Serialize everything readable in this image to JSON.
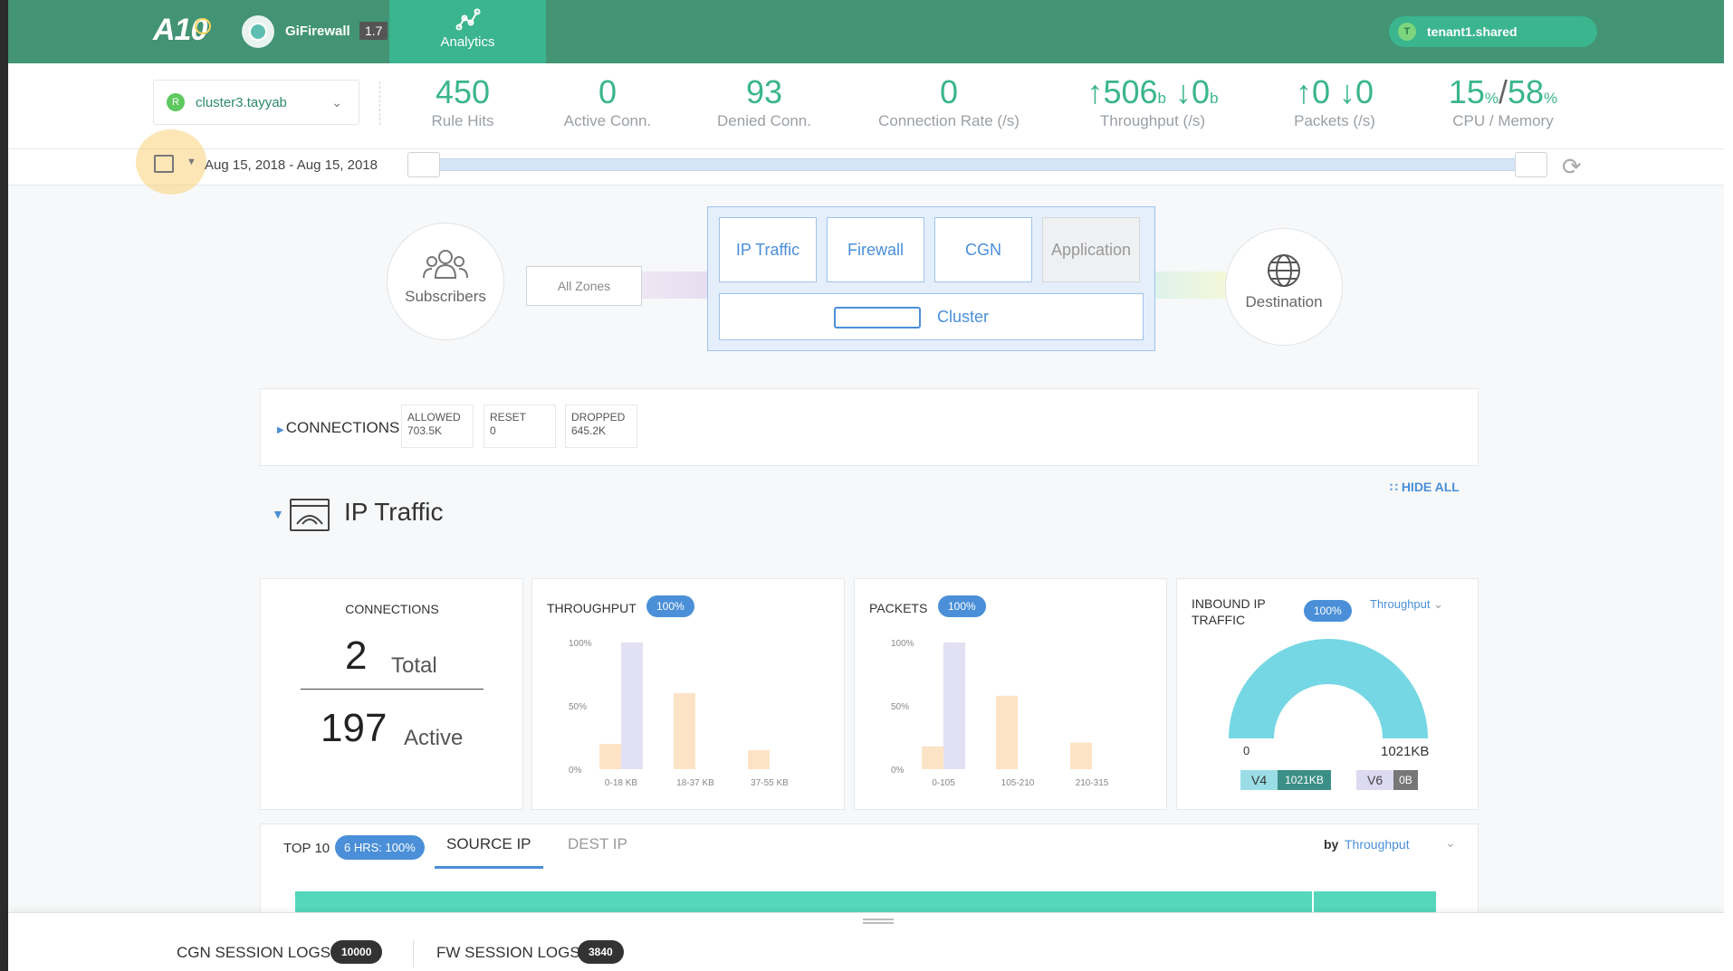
{
  "header": {
    "logo": "A10",
    "product": "GiFirewall",
    "version": "1.7",
    "analytics_tab": "Analytics",
    "tenant_initial": "T",
    "tenant": "tenant1.shared"
  },
  "cluster": {
    "initial": "R",
    "name": "cluster3.tayyab"
  },
  "stats": {
    "rule_hits": {
      "value": "450",
      "label": "Rule Hits"
    },
    "active_conn": {
      "value": "0",
      "label": "Active Conn."
    },
    "denied_conn": {
      "value": "93",
      "label": "Denied Conn."
    },
    "conn_rate": {
      "value": "0",
      "label": "Connection Rate (/s)"
    },
    "throughput": {
      "up": "↑506",
      "up_unit": "b",
      "down": "↓0",
      "down_unit": "b",
      "label": "Throughput (/s)"
    },
    "packets": {
      "up": "↑0",
      "down": "↓0",
      "label": "Packets (/s)"
    },
    "cpu_mem": {
      "cpu": "15",
      "cpu_unit": "%",
      "sep": "/",
      "mem": "58",
      "mem_unit": "%",
      "label": "CPU / Memory"
    }
  },
  "date_range": "Aug 15, 2018 - Aug 15, 2018",
  "topology": {
    "subscribers": "Subscribers",
    "all_zones": "All Zones",
    "buttons": [
      "IP Traffic",
      "Firewall",
      "CGN",
      "Application"
    ],
    "cluster": "Cluster",
    "destination": "Destination"
  },
  "connections_summary": {
    "title": "CONNECTIONS",
    "allowed_label": "ALLOWED",
    "allowed_value": "703.5K",
    "reset_label": "RESET",
    "reset_value": "0",
    "dropped_label": "DROPPED",
    "dropped_value": "645.2K"
  },
  "hide_all": "HIDE ALL",
  "section_title": "IP Traffic",
  "connections_card": {
    "title": "CONNECTIONS",
    "total": "2",
    "total_label": "Total",
    "active": "197",
    "active_label": "Active"
  },
  "throughput_card": {
    "title": "THROUGHPUT",
    "pct": "100%"
  },
  "packets_card": {
    "title": "PACKETS",
    "pct": "100%"
  },
  "inbound_card": {
    "title_line1": "INBOUND IP",
    "title_line2": "TRAFFIC",
    "pct": "100%",
    "metric": "Throughput",
    "min": "0",
    "max": "1021KB",
    "v4_label": "V4",
    "v4_value": "1021KB",
    "v6_label": "V6",
    "v6_value": "0B",
    "v4_fraction": 1.0
  },
  "chart_data": [
    {
      "type": "bar",
      "title": "THROUGHPUT",
      "categories": [
        "0-18 KB",
        "18-37 KB",
        "37-55 KB"
      ],
      "y_ticks": [
        "100%",
        "50%",
        "0%"
      ],
      "ylim": [
        0,
        100
      ],
      "series": [
        {
          "values": [
            20,
            60,
            15
          ]
        },
        {
          "values": [
            100,
            null,
            null
          ]
        }
      ]
    },
    {
      "type": "bar",
      "title": "PACKETS",
      "categories": [
        "0-105",
        "105-210",
        "210-315"
      ],
      "y_ticks": [
        "100%",
        "50%",
        "0%"
      ],
      "ylim": [
        0,
        100
      ],
      "series": [
        {
          "values": [
            18,
            58,
            21
          ]
        },
        {
          "values": [
            100,
            null,
            null
          ]
        }
      ]
    }
  ],
  "top10": {
    "title": "TOP 10",
    "pill": "6 HRS: 100%",
    "tab_source": "SOURCE IP",
    "tab_dest": "DEST IP",
    "by_label": "by",
    "by_value": "Throughput"
  },
  "footer": {
    "cgn_label": "CGN SESSION LOGS",
    "cgn_count": "10000",
    "fw_label": "FW SESSION LOGS",
    "fw_count": "3840"
  },
  "colors": {
    "header": "#439375",
    "accent": "#3ab58e",
    "link": "#4a8fd8",
    "bar_orange": "#fde3c6",
    "bar_lavender": "#e2e0f3",
    "gauge": "#76d7e4"
  }
}
